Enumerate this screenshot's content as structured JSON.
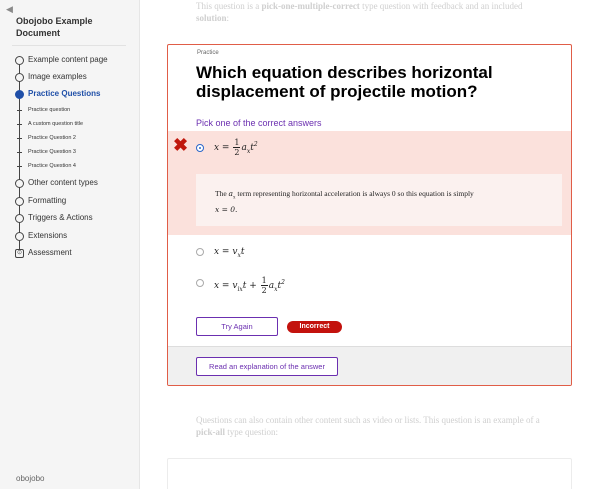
{
  "sidebar": {
    "collapse_glyph": "◀",
    "title": "Obojobo Example Document",
    "items": [
      {
        "label": "Example content page"
      },
      {
        "label": "Image examples"
      },
      {
        "label": "Practice Questions"
      },
      {
        "label": "Other content types"
      },
      {
        "label": "Formatting"
      },
      {
        "label": "Triggers & Actions"
      },
      {
        "label": "Extensions"
      },
      {
        "label": "Assessment",
        "badge": "⊙"
      }
    ],
    "subitems": [
      {
        "label": "Practice question"
      },
      {
        "label": "A custom question title"
      },
      {
        "label": "Practice Question 2"
      },
      {
        "label": "Practice Question 3"
      },
      {
        "label": "Practice Question 4"
      }
    ],
    "logo": "obojobo"
  },
  "content": {
    "top_text_1": "This question is a ",
    "top_text_bold": "pick-one-multiple-correct",
    "top_text_2": " type question with feedback and an included ",
    "top_text_bold_2": "solution",
    "top_text_3": ":",
    "bottom_text_1": "Questions can also contain other content such as video or lists. This question is an example of a ",
    "bottom_text_bold": "pick-all",
    "bottom_text_2": " type question:"
  },
  "question": {
    "tag": "Practice",
    "text": "Which equation describes horizontal displacement of projectile motion?",
    "instructions": "Pick one of the correct answers",
    "incorrect_mark": "✖",
    "answers": [
      {
        "lhs": "x = ",
        "frac_num": "1",
        "frac_den": "2",
        "rhs": "a",
        "sub": "x",
        "tail": "t",
        "sup": "2"
      },
      {
        "lhs": "x = v",
        "sub": "x",
        "tail": "t"
      },
      {
        "lhs": "x = v",
        "sub": "ix",
        "mid": "t + ",
        "frac_num": "1",
        "frac_den": "2",
        "rhs": "a",
        "sub2": "x",
        "tail": "t",
        "sup": "2"
      }
    ],
    "feedback_1": "The ",
    "feedback_var": "a",
    "feedback_sub": "x",
    "feedback_2": " term representing horizontal acceleration is always 0 so this equation is simply",
    "feedback_3": "x = 0.",
    "try_again_label": "Try Again",
    "result_badge": "Incorrect",
    "explanation_label": "Read an explanation of the answer"
  },
  "colors": {
    "accent_purple": "#6b2fb0",
    "incorrect_red": "#c3120d",
    "active_blue": "#1f4fa8",
    "card_border": "#e05d47",
    "selected_answer_bg": "#fbe1dc"
  }
}
